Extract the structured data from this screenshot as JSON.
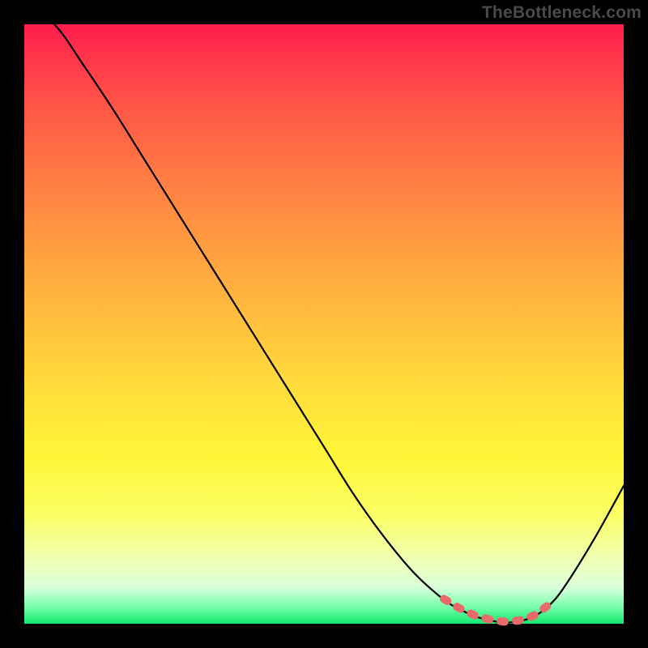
{
  "attribution": "TheBottleneck.com",
  "colors": {
    "frame_bg": "#000000",
    "curve_stroke": "#000000",
    "dash_stroke": "#e96a6a",
    "gradient_top": "#ff1d4d",
    "gradient_bottom": "#12e86f"
  },
  "chart_data": {
    "type": "line",
    "title": "",
    "xlabel": "",
    "ylabel": "",
    "x": [
      0.0,
      0.05,
      0.1,
      0.15,
      0.2,
      0.25,
      0.3,
      0.35,
      0.4,
      0.45,
      0.5,
      0.55,
      0.6,
      0.65,
      0.7,
      0.725,
      0.75,
      0.775,
      0.8,
      0.825,
      0.85,
      0.875,
      0.9,
      0.95,
      1.0
    ],
    "series": [
      {
        "name": "curve",
        "values": [
          1.03,
          1.0,
          0.93,
          0.855,
          0.775,
          0.695,
          0.615,
          0.535,
          0.455,
          0.375,
          0.295,
          0.215,
          0.145,
          0.085,
          0.04,
          0.025,
          0.013,
          0.006,
          0.002,
          0.004,
          0.012,
          0.03,
          0.06,
          0.14,
          0.23
        ]
      }
    ],
    "optimum_band": {
      "x_start": 0.7,
      "x_end": 0.88,
      "y_start": 0.04,
      "y_end": 0.035
    },
    "xlim": [
      0,
      1
    ],
    "ylim": [
      0,
      1
    ]
  }
}
